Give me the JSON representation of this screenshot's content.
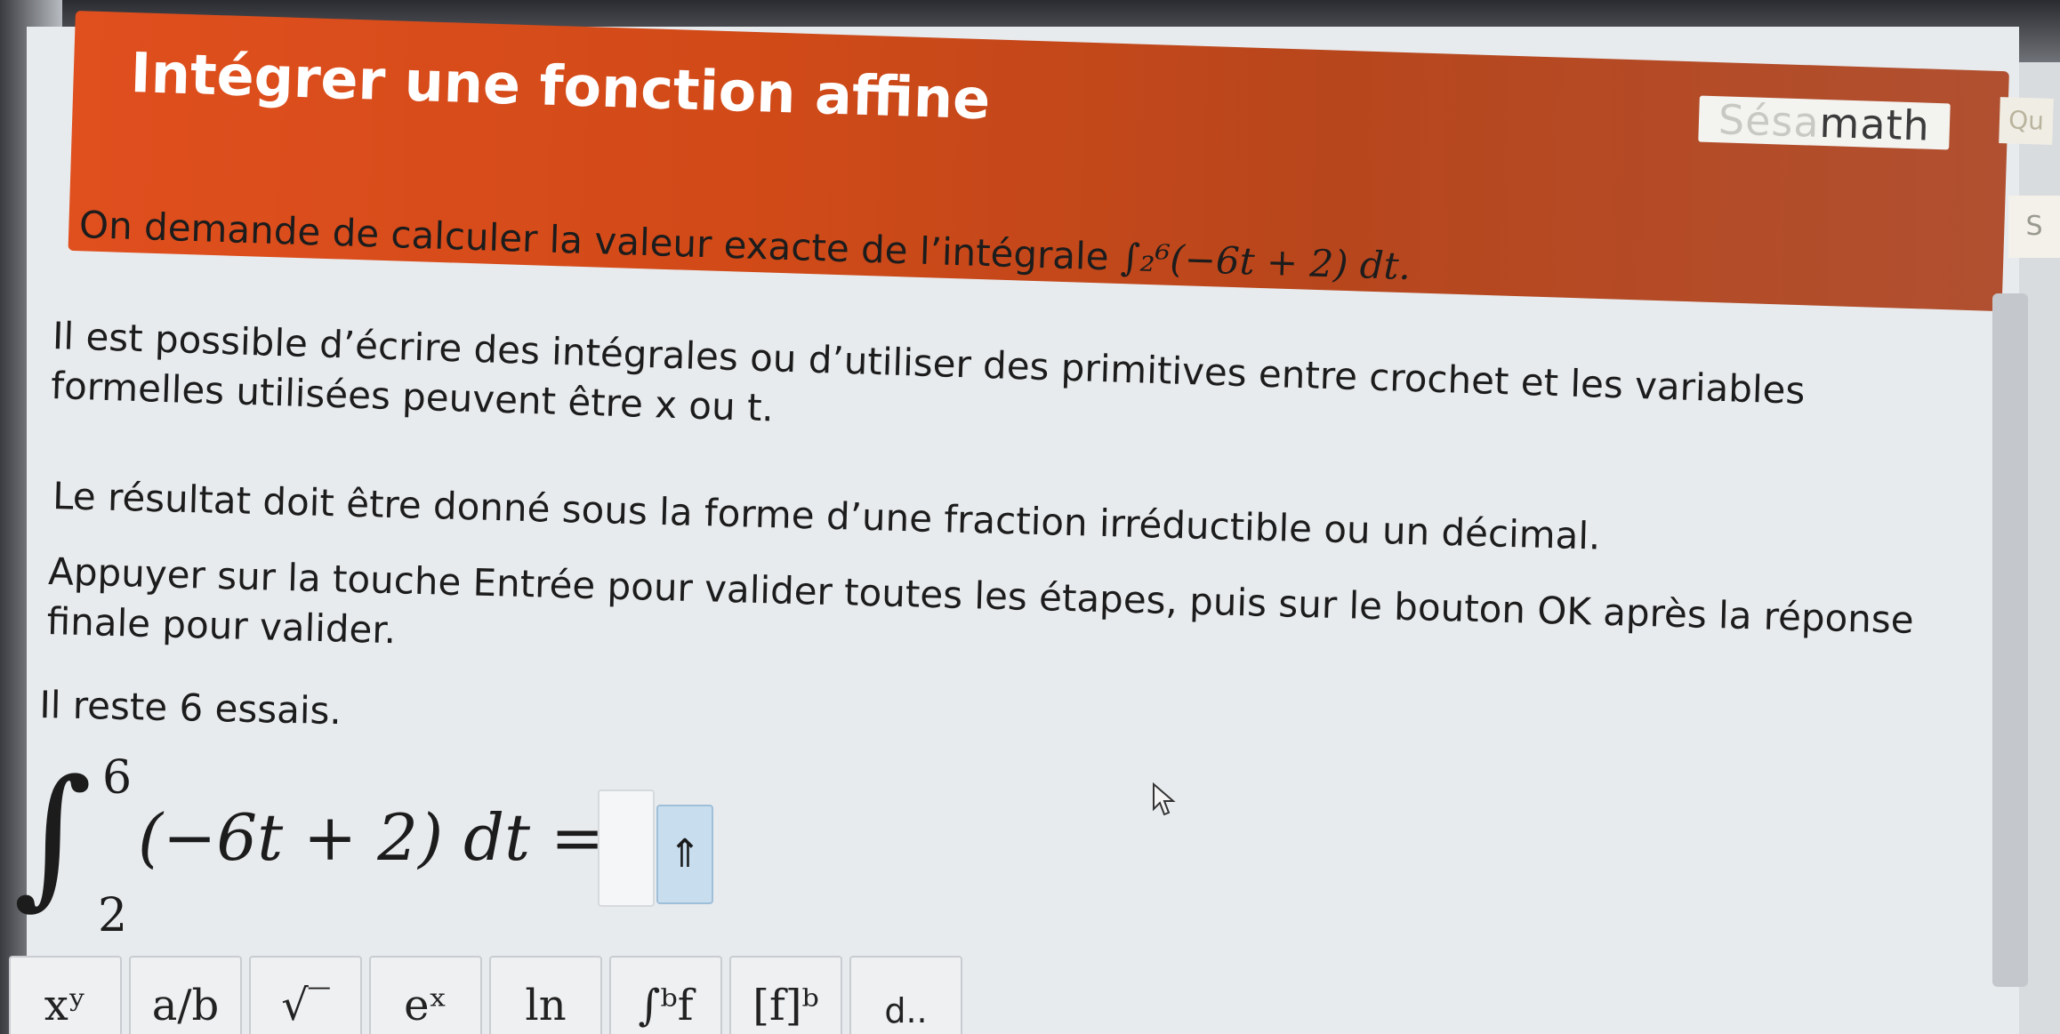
{
  "header": {
    "title": "Intégrer une fonction affine",
    "brand_faded": "Sésa",
    "brand": "math",
    "side_tab": "Qu",
    "side_tab2": "S"
  },
  "instructions": {
    "p1_text": "On demande de calculer la valeur exacte de l’intégrale ",
    "p1_integral": "∫₂⁶(−6t + 2) dt.",
    "p2": "Il est possible d’écrire des intégrales ou d’utiliser des primitives entre crochet et les variables formelles utilisées peuvent être x ou t.",
    "p3": "Le résultat doit être donné sous la forme d’une fraction irréductible ou un décimal.",
    "p4": "Appuyer sur la touche Entrée pour valider toutes les étapes, puis sur le bouton OK après la réponse finale pour valider.",
    "p5": "Il reste 6 essais."
  },
  "equation": {
    "integral_sign": "∫",
    "upper_bound": "6",
    "lower_bound": "2",
    "expression": "(−6t + 2) dt ="
  },
  "answer": {
    "value": "",
    "keyboard_toggle": "⇑"
  },
  "toolbar": {
    "buttons": [
      "xʸ",
      "a/b",
      "√‾",
      "eˣ",
      "ln",
      "∫ᵇf",
      "[f]ᵇ",
      "d.."
    ]
  },
  "colors": {
    "header_accent": "#e04f1e",
    "keyboard_button": "#c8ddee"
  }
}
